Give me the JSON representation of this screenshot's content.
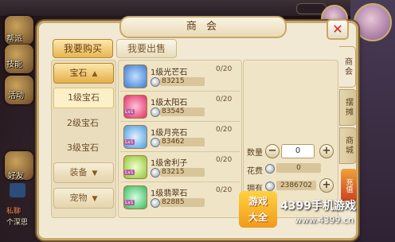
{
  "hud": {
    "left_buttons": [
      {
        "label": "帮派",
        "icon": "guild-icon"
      },
      {
        "label": "技能",
        "icon": "skill-icon"
      },
      {
        "label": "活动",
        "icon": "event-icon"
      },
      {
        "label": "好友",
        "icon": "friend-icon"
      }
    ],
    "chat_lines": [
      "私聊",
      "个深思"
    ]
  },
  "dialog": {
    "title": "商 会",
    "close_icon": "close-icon",
    "tabs": [
      {
        "label": "我要购买",
        "active": true
      },
      {
        "label": "我要出售",
        "active": false
      }
    ]
  },
  "categories": {
    "expanded": {
      "label": "宝石",
      "sub_items": [
        {
          "label": "1级宝石",
          "selected": true
        },
        {
          "label": "2级宝石",
          "selected": false
        },
        {
          "label": "3级宝石",
          "selected": false
        }
      ]
    },
    "collapsed": [
      {
        "label": "装备"
      },
      {
        "label": "宠物"
      }
    ]
  },
  "items": [
    {
      "name": "1级光芒石",
      "count": "0/20",
      "price": "83215",
      "icon": "light-stone-icon",
      "level_tag": "",
      "color": "#3f7ad0"
    },
    {
      "name": "1级太阳石",
      "count": "0/20",
      "price": "83545",
      "icon": "sun-stone-icon",
      "level_tag": "Lv1",
      "color": "#e0306a"
    },
    {
      "name": "1级月亮石",
      "count": "0/20",
      "price": "83462",
      "icon": "moon-stone-icon",
      "level_tag": "Lv1",
      "color": "#4a9be0"
    },
    {
      "name": "1级舍利子",
      "count": "0/20",
      "price": "83215",
      "icon": "relic-icon",
      "level_tag": "Lv1",
      "color": "#8fc43a"
    },
    {
      "name": "1级翡翠石",
      "count": "0/20",
      "price": "82885",
      "icon": "jade-stone-icon",
      "level_tag": "Lv1",
      "color": "#3cb861"
    }
  ],
  "detail": {
    "quantity_label": "数量",
    "quantity_value": "0",
    "cost_label": "花费",
    "cost_value": "0",
    "own_label": "拥有",
    "own_value": "2386702"
  },
  "side_tabs": [
    {
      "label": "商会",
      "active": true
    },
    {
      "label": "摆摊",
      "active": false
    },
    {
      "label": "商城",
      "active": false
    }
  ],
  "recharge_label": "充值",
  "watermark": {
    "logo_line1": "游戏",
    "logo_line2": "大全",
    "brand": "4399手机游戏",
    "url": "www.4399.cn"
  }
}
